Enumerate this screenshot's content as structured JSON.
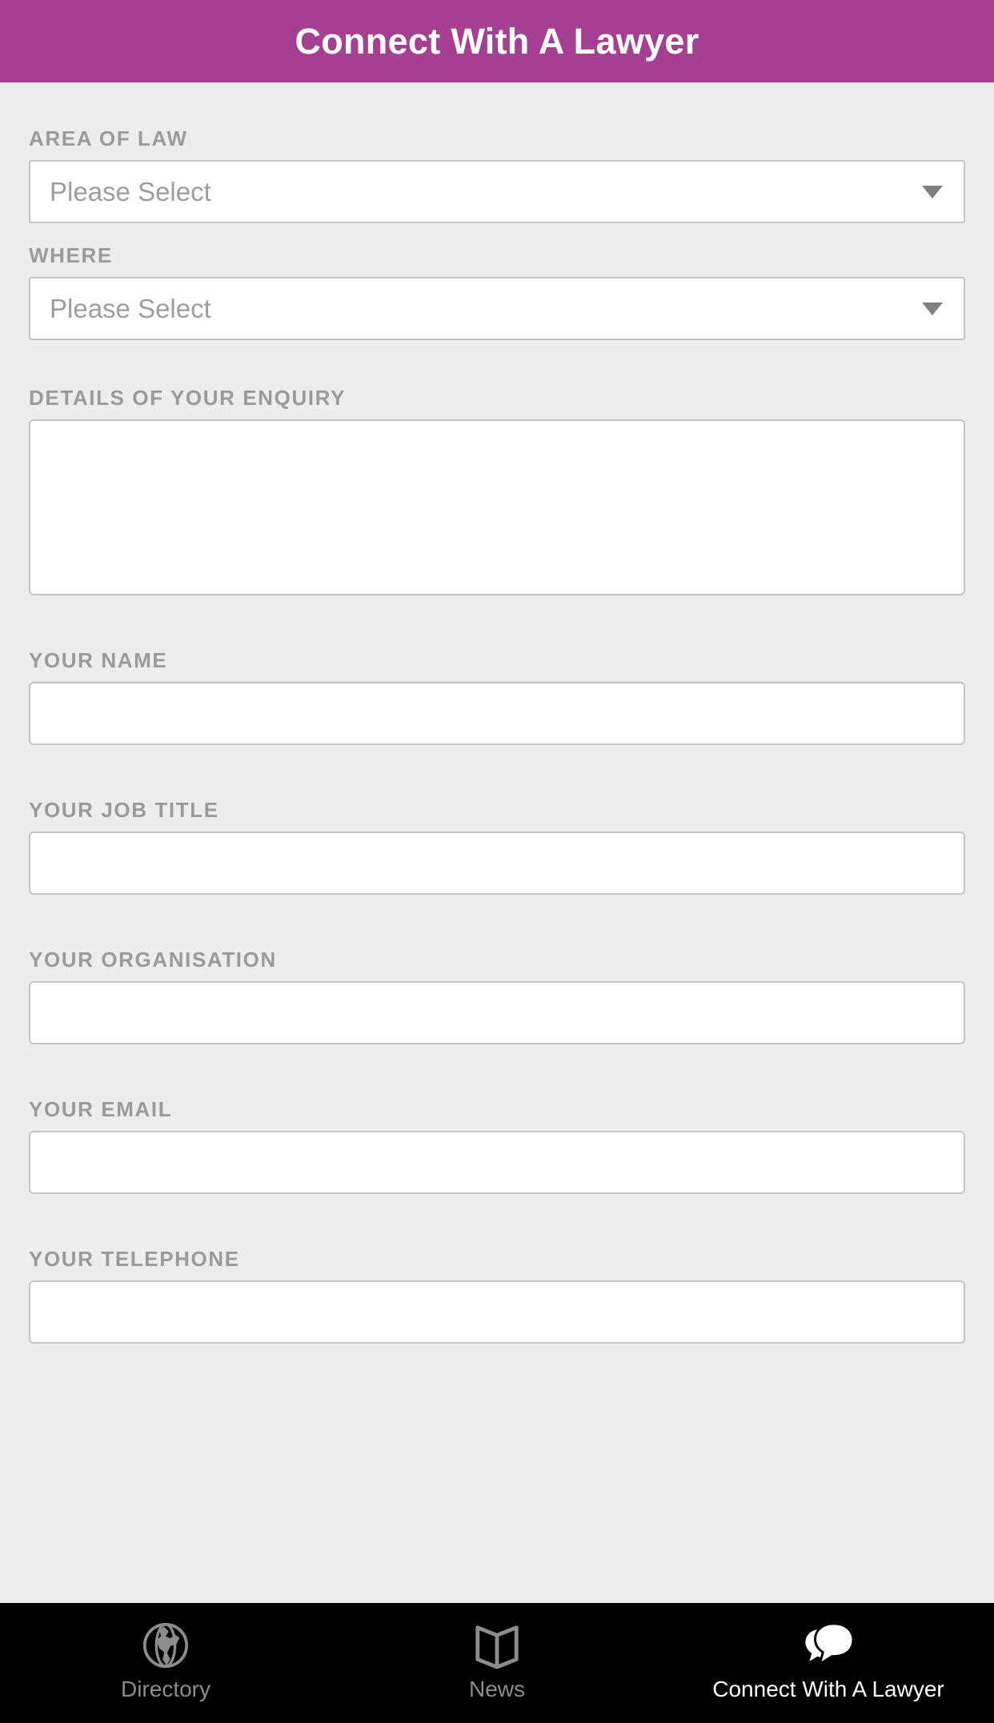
{
  "header": {
    "title": "Connect With A Lawyer",
    "background_color": "#A63E92",
    "text_color": "#FFFFFF"
  },
  "page": {
    "background_color": "#EDEDED",
    "label_color": "#9A9A9A",
    "input_border_color": "#C4C4C4"
  },
  "form": {
    "fields": [
      {
        "key": "area_of_law",
        "label": "AREA OF LAW",
        "type": "select",
        "value": "Please Select",
        "icon": "chevron-down-icon"
      },
      {
        "key": "where",
        "label": "WHERE",
        "type": "select",
        "value": "Please Select",
        "icon": "chevron-down-icon"
      },
      {
        "key": "details_of_your_enquiry",
        "label": "DETAILS OF YOUR ENQUIRY",
        "type": "textarea",
        "value": "",
        "placeholder": ""
      },
      {
        "key": "your_name",
        "label": "YOUR NAME",
        "type": "text",
        "value": "",
        "placeholder": ""
      },
      {
        "key": "your_job_title",
        "label": "YOUR JOB TITLE",
        "type": "text",
        "value": "",
        "placeholder": ""
      },
      {
        "key": "your_organisation",
        "label": "YOUR ORGANISATION",
        "type": "text",
        "value": "",
        "placeholder": ""
      },
      {
        "key": "your_email",
        "label": "YOUR EMAIL",
        "type": "text",
        "value": "",
        "placeholder": ""
      },
      {
        "key": "your_telephone",
        "label": "YOUR TELEPHONE",
        "type": "text",
        "value": "",
        "placeholder": ""
      }
    ]
  },
  "bottom_nav": {
    "background_color": "#000000",
    "active_color": "#FFFFFF",
    "inactive_color": "#8C8C8C",
    "items": [
      {
        "label": "Directory",
        "icon": "globe-icon",
        "active": false
      },
      {
        "label": "News",
        "icon": "open-book-icon",
        "active": false
      },
      {
        "label": "Connect With A Lawyer",
        "icon": "speech-bubbles-icon",
        "active": true
      }
    ]
  }
}
